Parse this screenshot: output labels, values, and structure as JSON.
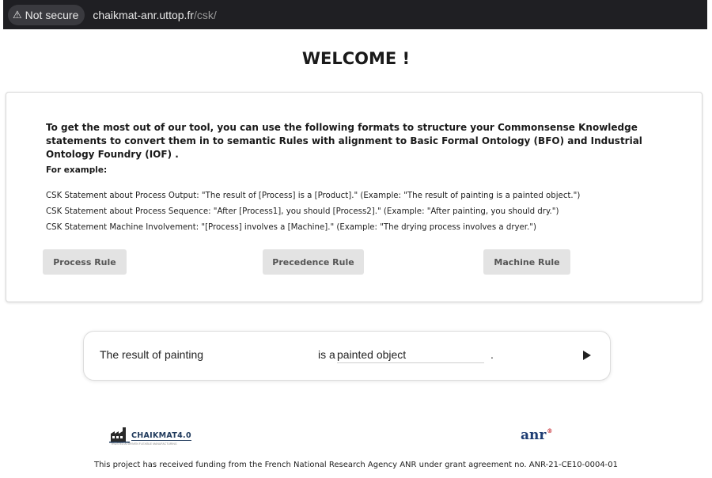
{
  "browser": {
    "security_label": "Not secure",
    "url_host": "chaikmat-anr.uttop.fr",
    "url_path": "/csk/"
  },
  "page": {
    "title": "WELCOME !"
  },
  "intro": {
    "text": "To get the most out of our tool, you can use the following formats to structure your Commonsense Knowledge statements to convert them in to semantic Rules with alignment to Basic Formal Ontology (BFO) and Industrial Ontology Foundry (IOF) .",
    "example_heading": "For example:",
    "examples": [
      "CSK Statement about Process Output: \"The result of [Process] is a [Product].\" (Example: \"The result of painting is a painted object.\")",
      "CSK Statement about Process Sequence: \"After [Process1], you should [Process2].\" (Example: \"After painting, you should dry.\")",
      "CSK Statement Machine Involvement: \"[Process] involves a [Machine].\" (Example: \"The drying process involves a dryer.\")"
    ]
  },
  "rule_buttons": {
    "process": "Process Rule",
    "precedence": "Precedence Rule",
    "machine": "Machine Rule"
  },
  "statement": {
    "prefix": "The result of",
    "process_value": "painting",
    "middle": "is a",
    "product_value": "painted object",
    "end": "."
  },
  "footer": {
    "chaikmat_logo_text": "CHAIKMAT4.0",
    "chaikmat_tagline": "TRUSTED AI DRIVEN FLEXIBLE MANUFACTURING",
    "anr_logo_text": "anr",
    "anr_reg_mark": "®",
    "funding_text": "This project has received funding from the French National Research Agency ANR under grant agreement no. ANR-21-CE10-0004-01"
  },
  "icons": {
    "warning": "warning-triangle-icon",
    "submit": "play-icon"
  }
}
